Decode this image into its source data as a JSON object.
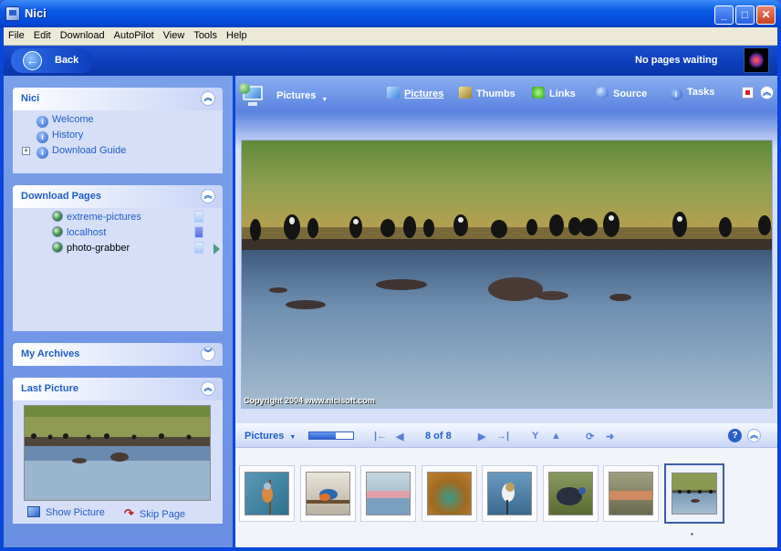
{
  "window": {
    "title": "Nici",
    "min": "_",
    "max": "□",
    "close": "✕"
  },
  "menu": [
    "File",
    "Edit",
    "Download",
    "AutoPilot",
    "View",
    "Tools",
    "Help"
  ],
  "navbar": {
    "back_label": "Back",
    "status": "No pages waiting"
  },
  "sidebar": {
    "nici": {
      "title": "Nici",
      "items": [
        "Welcome",
        "History",
        "Download Guide"
      ]
    },
    "download_pages": {
      "title": "Download Pages",
      "items": [
        "extreme-pictures",
        "localhost",
        "photo-grabber"
      ]
    },
    "my_archives": {
      "title": "My Archives"
    },
    "last_picture": {
      "title": "Last Picture",
      "show_picture": "Show Picture",
      "skip_page": "Skip Page"
    }
  },
  "main": {
    "view_dropdown": "Pictures",
    "tabs": [
      "Pictures",
      "Thumbs",
      "Links",
      "Source",
      "Tasks"
    ],
    "copyright": "Copyright 2004 www.nicisoft.com"
  },
  "strip": {
    "dropdown": "Pictures",
    "page_count": "8 of 8",
    "progress": 0.6,
    "help": "?"
  },
  "icons": {
    "back": "left-arrow-icon",
    "info": "info-icon",
    "globe": "globe-icon",
    "expand": "expand-icon"
  }
}
